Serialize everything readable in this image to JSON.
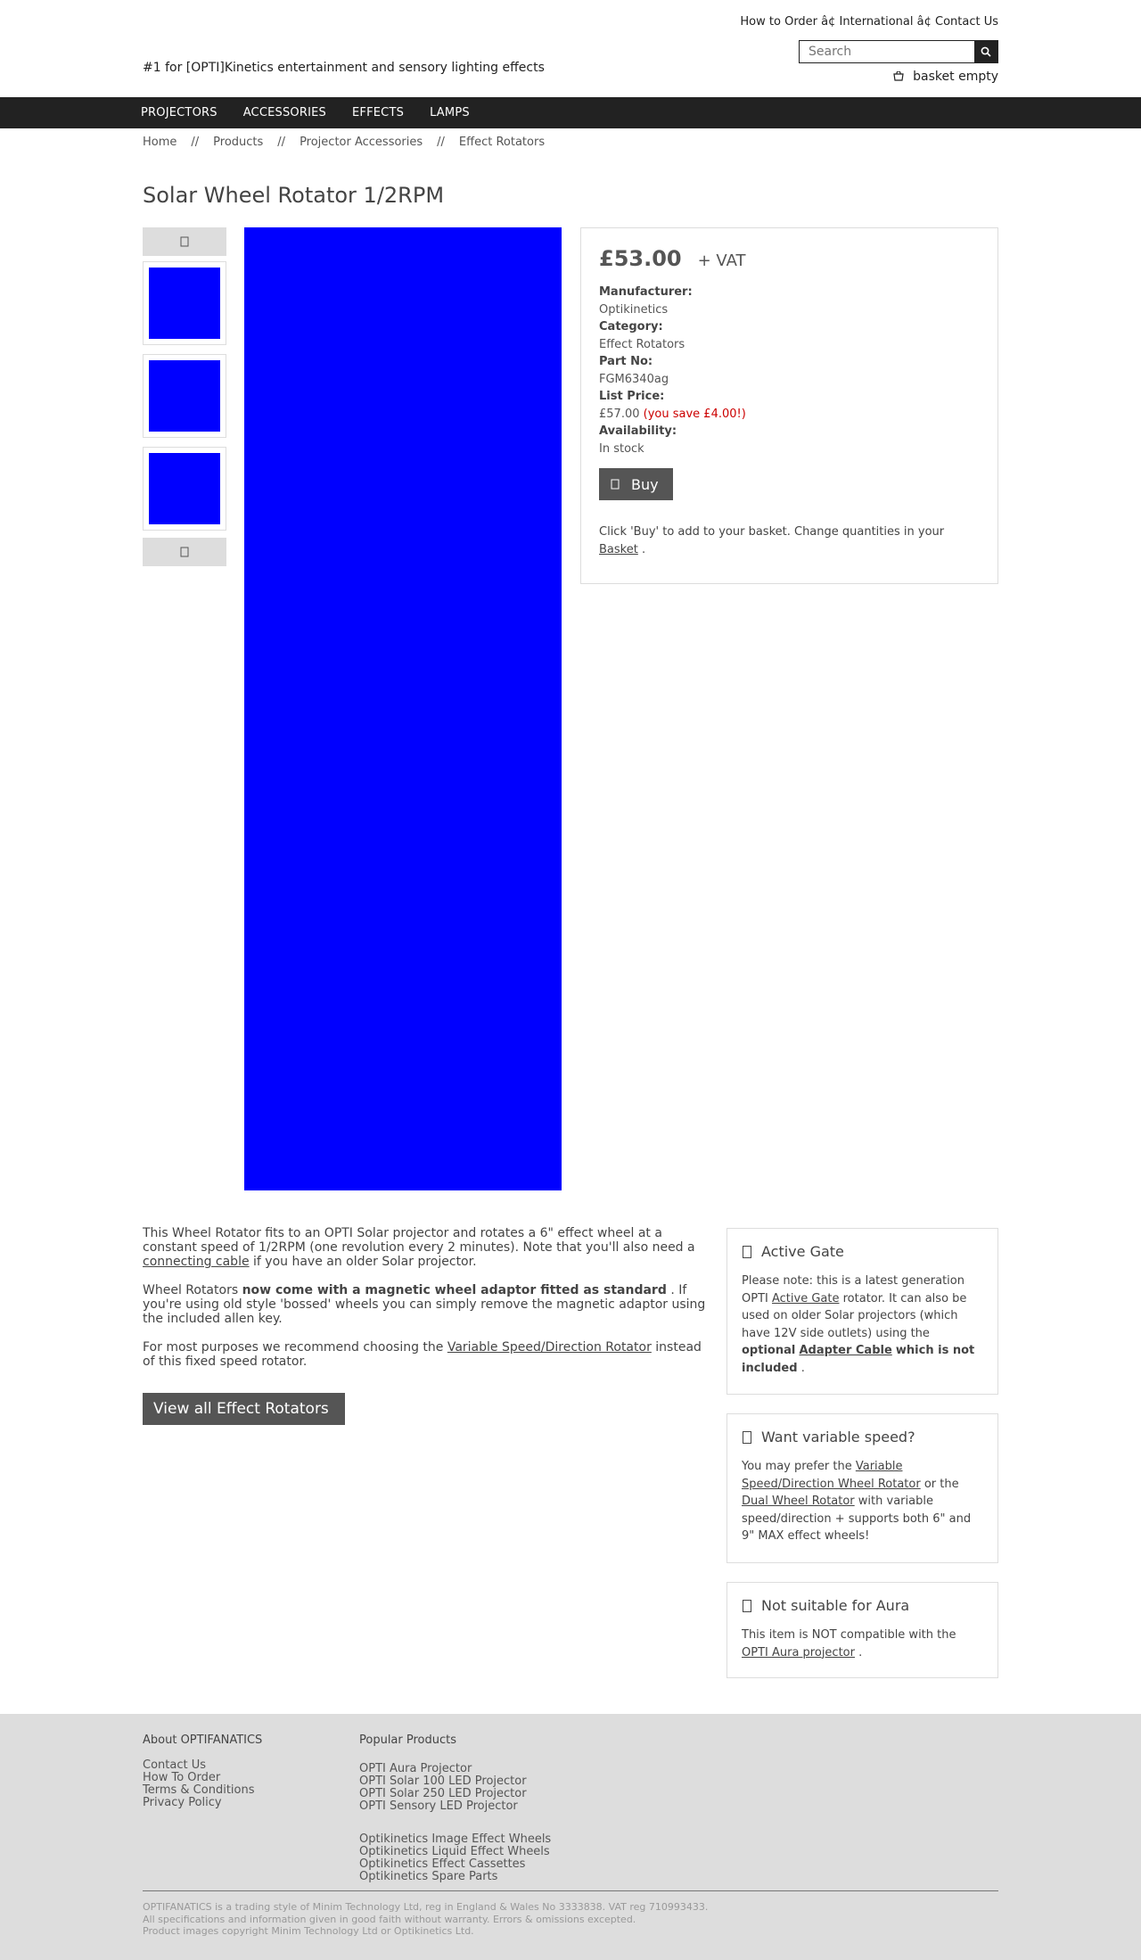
{
  "header": {
    "top_links": "How to Order â¢ International â¢ Contact Us",
    "tagline": "#1 for [OPTI]Kinetics entertainment and sensory lighting effects",
    "search_placeholder": "Search",
    "search_icon": "search-icon",
    "basket_icon": "basket-icon",
    "basket_label": "basket empty"
  },
  "nav": {
    "items": [
      "PROJECTORS",
      "ACCESSORIES",
      "EFFECTS",
      "LAMPS"
    ]
  },
  "breadcrumb": {
    "items": [
      "Home",
      "Products",
      "Projector Accessories",
      "Effect Rotators"
    ],
    "separator": "//"
  },
  "product": {
    "title": "Solar Wheel Rotator 1/2RPM",
    "image_color": "#0000ff",
    "thumb_up_icon": "chevron-up-icon",
    "thumb_down_icon": "chevron-down-icon",
    "price": "£53.00",
    "vat": "+ VAT",
    "manufacturer_label": "Manufacturer:",
    "manufacturer": "Optikinetics",
    "category_label": "Category:",
    "category": "Effect Rotators",
    "part_label": "Part No:",
    "part_no": "FGM6340ag",
    "list_price_label": "List Price:",
    "list_price": "£57.00",
    "saving": "(you save £4.00!)",
    "availability_label": "Availability:",
    "availability": "In stock",
    "buy_icon": "cart-icon",
    "buy_label": "Buy",
    "buy_note_prefix": "Click 'Buy' to add to your basket. Change quantities in your",
    "buy_note_link": "Basket",
    "buy_note_suffix": "."
  },
  "description": {
    "p1_a": "This Wheel Rotator fits to an OPTI Solar projector and rotates a 6\" effect wheel at a constant speed of 1/2RPM (one revolution every 2 minutes). Note that you'll also need a",
    "p1_link": "connecting cable",
    "p1_b": "if you have an older Solar projector.",
    "p2_a": "Wheel Rotators",
    "p2_bold": "now come with a magnetic wheel adaptor fitted as standard",
    "p2_b": ". If you're using old style 'bossed' wheels you can simply remove the magnetic adaptor using the included allen key.",
    "p3_a": "For most purposes we recommend choosing the",
    "p3_link": "Variable Speed/Direction Rotator",
    "p3_b": "instead of this fixed speed rotator.",
    "view_all": "View all Effect Rotators"
  },
  "sidebar": {
    "box1": {
      "icon": "info-icon",
      "title": "Active Gate",
      "t1": "Please note: this is a latest generation OPTI",
      "link1": "Active Gate",
      "t2": "rotator. It can also be used on older Solar projectors (which have 12V side outlets) using the",
      "bold1": "optional",
      "link2": "Adapter Cable",
      "bold2": "which is not included",
      "t3": "."
    },
    "box2": {
      "icon": "info-icon",
      "title": "Want variable speed?",
      "t1": "You may prefer the",
      "link1": "Variable Speed/Direction Wheel Rotator",
      "t2": "or the",
      "link2": "Dual Wheel Rotator",
      "t3": "with variable speed/direction + supports both 6\" and 9\" MAX effect wheels!"
    },
    "box3": {
      "icon": "warning-icon",
      "title": "Not suitable for Aura",
      "t1": "This item is NOT compatible with the",
      "link1": "OPTI Aura projector",
      "t2": "."
    }
  },
  "footer": {
    "about_head": "About OPTIFANATICS",
    "about_links": [
      "Contact Us",
      "How To Order",
      "Terms & Conditions",
      "Privacy Policy"
    ],
    "popular_head": "Popular Products",
    "popular_links_1": [
      "OPTI Aura Projector",
      "OPTI Solar 100 LED Projector",
      "OPTI Solar 250 LED Projector",
      "OPTI Sensory LED Projector"
    ],
    "popular_links_2": [
      "Optikinetics Image Effect Wheels",
      "Optikinetics Liquid Effect Wheels",
      "Optikinetics Effect Cassettes",
      "Optikinetics Spare Parts"
    ],
    "legal": [
      "OPTIFANATICS is a trading style of Minim Technology Ltd, reg in England & Wales No 3333838. VAT reg 710993433.",
      "All specifications and information given in good faith without warranty. Errors & omissions excepted.",
      "Product images copyright Minim Technology Ltd or Optikinetics Ltd."
    ]
  }
}
